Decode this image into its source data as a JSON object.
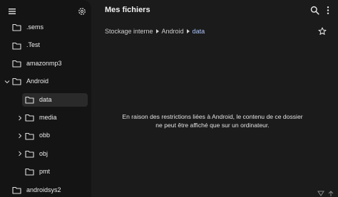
{
  "sidebar": {
    "menu_icon": "hamburger-icon",
    "settings_icon": "gear-icon",
    "items": [
      {
        "label": ".sems",
        "expandable": false,
        "expanded": false,
        "depth": 0,
        "selected": false
      },
      {
        "label": ".Test",
        "expandable": false,
        "expanded": false,
        "depth": 0,
        "selected": false
      },
      {
        "label": "amazonmp3",
        "expandable": false,
        "expanded": false,
        "depth": 0,
        "selected": false
      },
      {
        "label": "Android",
        "expandable": true,
        "expanded": true,
        "depth": 0,
        "selected": false
      },
      {
        "label": "data",
        "expandable": false,
        "expanded": false,
        "depth": 1,
        "selected": true
      },
      {
        "label": "media",
        "expandable": true,
        "expanded": false,
        "depth": 1,
        "selected": false
      },
      {
        "label": "obb",
        "expandable": true,
        "expanded": false,
        "depth": 1,
        "selected": false
      },
      {
        "label": "obj",
        "expandable": true,
        "expanded": false,
        "depth": 1,
        "selected": false
      },
      {
        "label": "pmt",
        "expandable": false,
        "expanded": false,
        "depth": 1,
        "selected": false
      },
      {
        "label": "androidsys2",
        "expandable": false,
        "expanded": false,
        "depth": 0,
        "selected": false
      }
    ]
  },
  "header": {
    "title": "Mes fichiers",
    "search_icon": "search-icon",
    "more_icon": "more-vert-icon"
  },
  "breadcrumb": {
    "items": [
      "Stockage interne",
      "Android",
      "data"
    ],
    "favorite_icon": "star-outline-icon"
  },
  "main": {
    "message": "En raison des restrictions liées à Android, le contenu de ce dossier ne peut être affiché que sur un ordinateur."
  },
  "colors": {
    "background": "#1b1b1b",
    "sidebar": "#141414",
    "selected_item": "#2a2a2a",
    "breadcrumb_current": "#aac4ff",
    "text": "#e6e6e6"
  }
}
